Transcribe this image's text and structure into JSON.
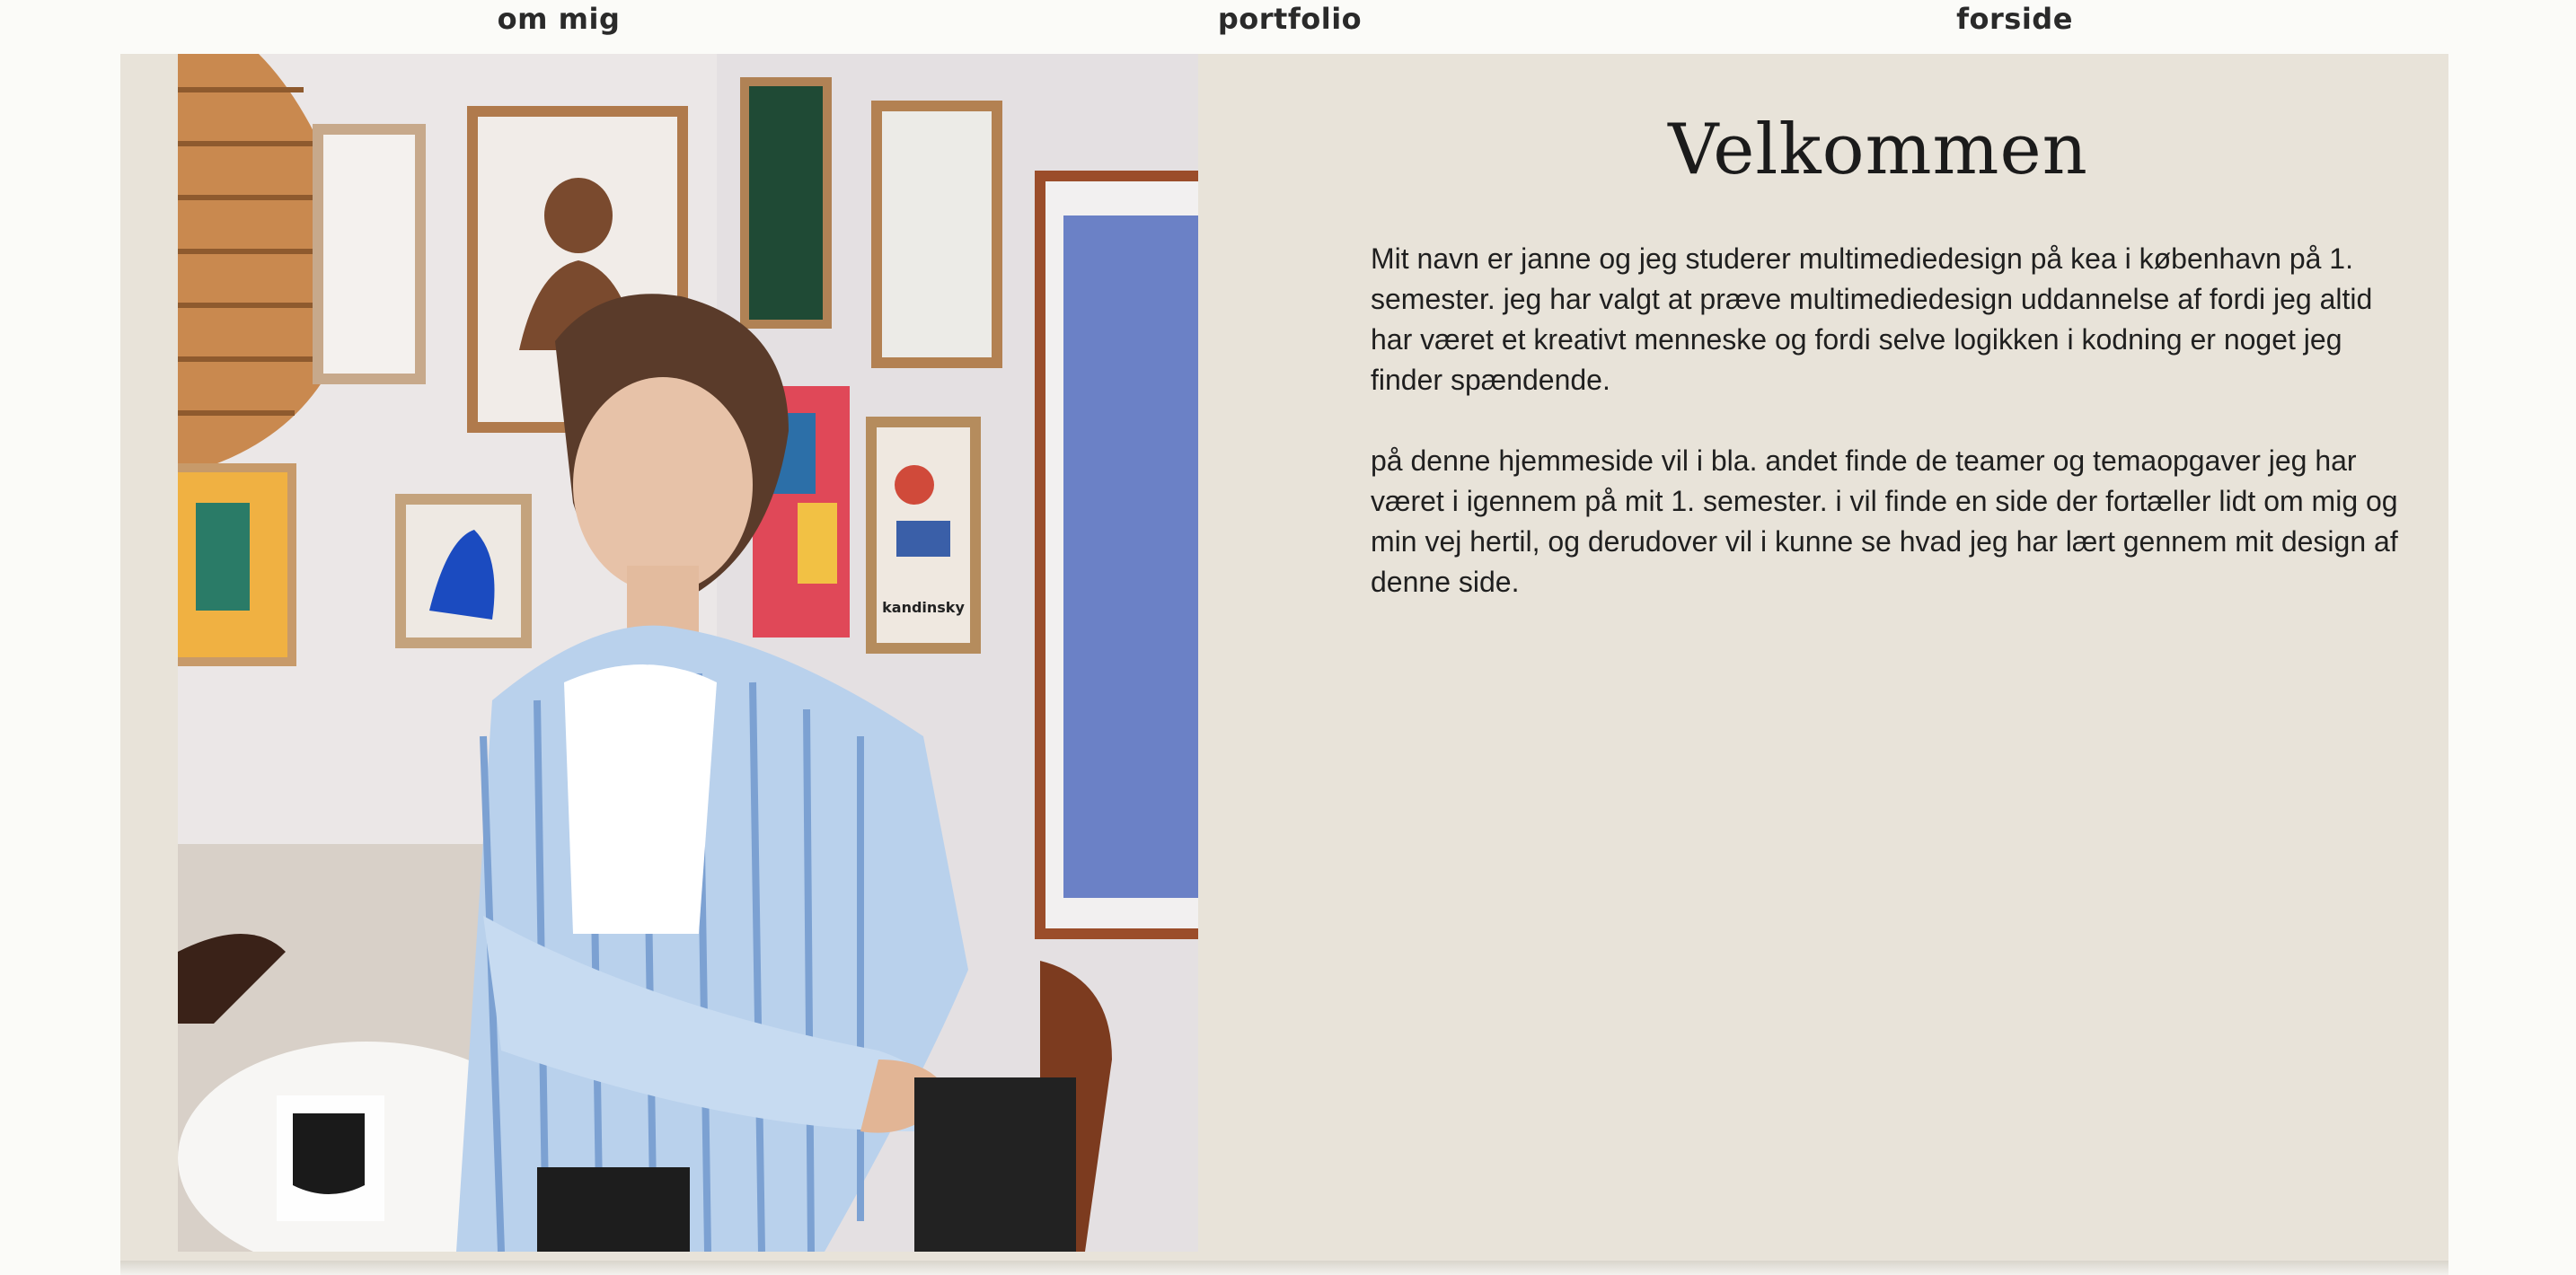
{
  "nav": {
    "items": [
      {
        "label": "om mig"
      },
      {
        "label": "portfolio"
      },
      {
        "label": "forside"
      }
    ]
  },
  "main": {
    "title": "Velkommen",
    "paragraphs": [
      "Mit navn er janne og jeg studerer multimediedesign på kea i københavn på 1. semester. jeg har valgt at præve multimediedesign uddannelse af fordi jeg altid har været et kreativt menneske og fordi selve logikken i kodning er noget jeg finder spændende.",
      "på denne hjemmeside vil i bla. andet finde de teamer og temaopgaver jeg har været i igennem på mit 1. semester. i vil finde en side der fortæller lidt om mig og min vej hertil, og derudover vil i kunne se hvad jeg har lært gennem mit design af denne side."
    ],
    "photo": {
      "poster_text": "kandinsky"
    }
  },
  "colors": {
    "page_bg": "#fbfbf8",
    "panel_bg": "#e8e3d9",
    "text": "#1f1f1f"
  }
}
